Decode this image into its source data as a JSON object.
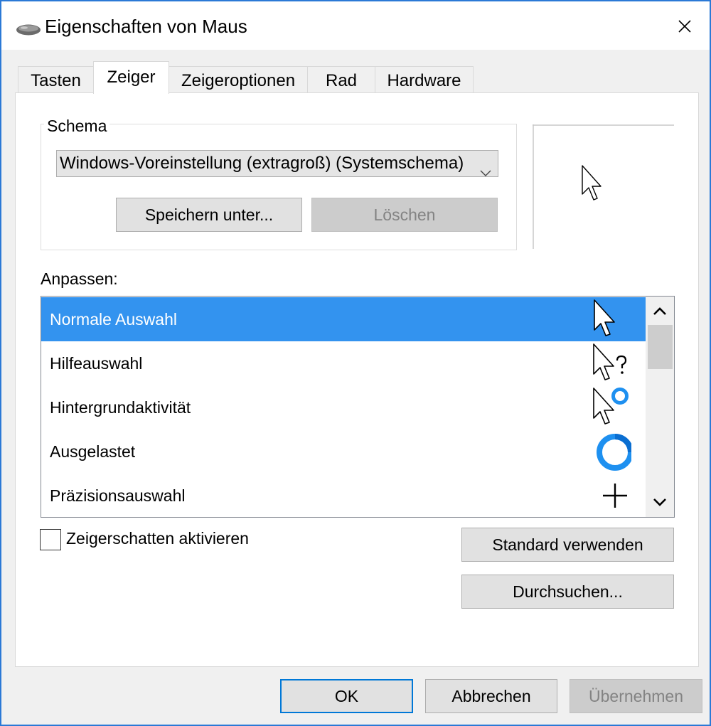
{
  "window": {
    "title": "Eigenschaften von Maus",
    "accent_color": "#2b79d6"
  },
  "icons": {
    "app": "mouse-icon",
    "close": "close-icon",
    "combo_arrow": "chevron-down-icon",
    "scroll_up": "chevron-up-icon",
    "scroll_down": "chevron-down-icon"
  },
  "tabs": [
    {
      "label": "Tasten",
      "active": false
    },
    {
      "label": "Zeiger",
      "active": true
    },
    {
      "label": "Zeigeroptionen",
      "active": false
    },
    {
      "label": "Rad",
      "active": false
    },
    {
      "label": "Hardware",
      "active": false
    }
  ],
  "schema": {
    "label": "Schema",
    "selected": "Windows-Voreinstellung (extragroß) (Systemschema)",
    "save_label": "Speichern unter...",
    "delete_label": "Löschen",
    "delete_enabled": false
  },
  "customize": {
    "label": "Anpassen:",
    "selection_color": "#3393ef",
    "items": [
      {
        "label": "Normale Auswahl",
        "icon": "arrow-cursor-icon",
        "selected": true
      },
      {
        "label": "Hilfeauswahl",
        "icon": "help-cursor-icon",
        "selected": false
      },
      {
        "label": "Hintergrundaktivität",
        "icon": "working-in-background-cursor-icon",
        "selected": false
      },
      {
        "label": "Ausgelastet",
        "icon": "busy-cursor-icon",
        "selected": false
      },
      {
        "label": "Präzisionsauswahl",
        "icon": "crosshair-cursor-icon",
        "selected": false
      }
    ]
  },
  "shadow": {
    "label": "Zeigerschatten aktivieren",
    "checked": false
  },
  "buttons": {
    "use_default": "Standard verwenden",
    "browse": "Durchsuchen...",
    "ok": "OK",
    "cancel": "Abbrechen",
    "apply": "Übernehmen",
    "apply_enabled": false
  }
}
